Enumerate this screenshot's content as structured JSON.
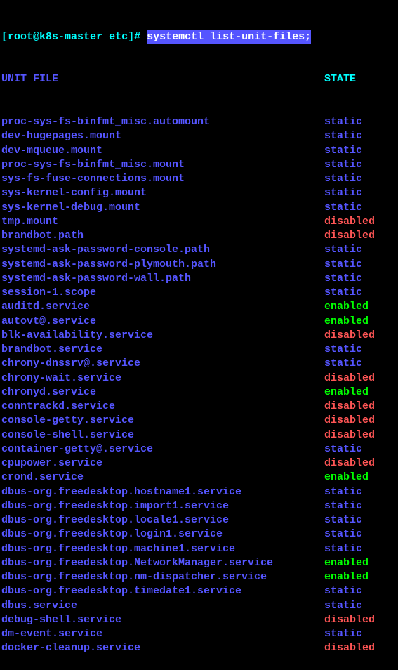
{
  "prompt": {
    "open_bracket": "[",
    "user": "root",
    "at_symbol": "@",
    "host": "k8s-master",
    "space1": " ",
    "path": "etc",
    "close_bracket": "]",
    "hash": "# "
  },
  "command": "systemctl list-unit-files;",
  "header": {
    "unit": "UNIT FILE",
    "state": "STATE"
  },
  "units": [
    {
      "name": "proc-sys-fs-binfmt_misc.automount",
      "state": "static"
    },
    {
      "name": "dev-hugepages.mount",
      "state": "static"
    },
    {
      "name": "dev-mqueue.mount",
      "state": "static"
    },
    {
      "name": "proc-sys-fs-binfmt_misc.mount",
      "state": "static"
    },
    {
      "name": "sys-fs-fuse-connections.mount",
      "state": "static"
    },
    {
      "name": "sys-kernel-config.mount",
      "state": "static"
    },
    {
      "name": "sys-kernel-debug.mount",
      "state": "static"
    },
    {
      "name": "tmp.mount",
      "state": "disabled"
    },
    {
      "name": "brandbot.path",
      "state": "disabled"
    },
    {
      "name": "systemd-ask-password-console.path",
      "state": "static"
    },
    {
      "name": "systemd-ask-password-plymouth.path",
      "state": "static"
    },
    {
      "name": "systemd-ask-password-wall.path",
      "state": "static"
    },
    {
      "name": "session-1.scope",
      "state": "static"
    },
    {
      "name": "auditd.service",
      "state": "enabled"
    },
    {
      "name": "autovt@.service",
      "state": "enabled"
    },
    {
      "name": "blk-availability.service",
      "state": "disabled"
    },
    {
      "name": "brandbot.service",
      "state": "static"
    },
    {
      "name": "chrony-dnssrv@.service",
      "state": "static"
    },
    {
      "name": "chrony-wait.service",
      "state": "disabled"
    },
    {
      "name": "chronyd.service",
      "state": "enabled"
    },
    {
      "name": "conntrackd.service",
      "state": "disabled"
    },
    {
      "name": "console-getty.service",
      "state": "disabled"
    },
    {
      "name": "console-shell.service",
      "state": "disabled"
    },
    {
      "name": "container-getty@.service",
      "state": "static"
    },
    {
      "name": "cpupower.service",
      "state": "disabled"
    },
    {
      "name": "crond.service",
      "state": "enabled"
    },
    {
      "name": "dbus-org.freedesktop.hostname1.service",
      "state": "static"
    },
    {
      "name": "dbus-org.freedesktop.import1.service",
      "state": "static"
    },
    {
      "name": "dbus-org.freedesktop.locale1.service",
      "state": "static"
    },
    {
      "name": "dbus-org.freedesktop.login1.service",
      "state": "static"
    },
    {
      "name": "dbus-org.freedesktop.machine1.service",
      "state": "static"
    },
    {
      "name": "dbus-org.freedesktop.NetworkManager.service",
      "state": "enabled"
    },
    {
      "name": "dbus-org.freedesktop.nm-dispatcher.service",
      "state": "enabled"
    },
    {
      "name": "dbus-org.freedesktop.timedate1.service",
      "state": "static"
    },
    {
      "name": "dbus.service",
      "state": "static"
    },
    {
      "name": "debug-shell.service",
      "state": "disabled"
    },
    {
      "name": "dm-event.service",
      "state": "static"
    },
    {
      "name": "docker-cleanup.service",
      "state": "disabled"
    }
  ]
}
